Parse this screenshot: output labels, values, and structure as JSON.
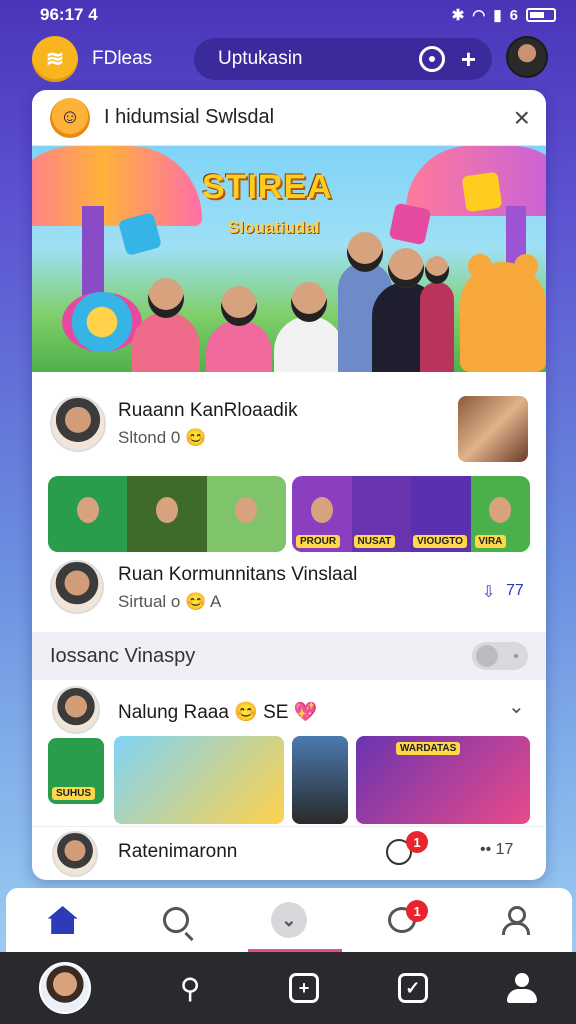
{
  "status_bar": {
    "time": "96:17 4",
    "battery": "6"
  },
  "app_bar": {
    "brand": "FDleas",
    "search_text": "Uptukasin"
  },
  "card": {
    "header_title": "I hidumsial Swlsdal",
    "close": "×"
  },
  "banner": {
    "title": "STIREA",
    "subtitle": "Slouatiudal"
  },
  "post1": {
    "title": "Ruaann KanRloaadik",
    "subtitle": "Sltond 0 😊"
  },
  "strip1": {
    "label_a": "PROUR",
    "label_b": "NUSAT",
    "label_c": "VIOUGTO",
    "label_d": "VIRA"
  },
  "post2": {
    "title": "Ruan Kormunnitans Vinslaal",
    "subtitle": "Sirtual o 😊 A",
    "likes": "77"
  },
  "section": {
    "title": "Iossanc Vinaspy"
  },
  "post3": {
    "title": "Nalung Raaa 😊 SE 💖",
    "tags": [
      "SUHUS",
      "WARDATAS"
    ]
  },
  "post4": {
    "title": "Ratenimaronn",
    "badge": "1",
    "meta": "•• 17"
  },
  "tab_bar": {
    "chat_badge": "1"
  },
  "colors": {
    "accent": "#2c3bb8",
    "brand": "#f8b51e",
    "badge": "#e8252e",
    "indicator": "#e64a8c"
  }
}
